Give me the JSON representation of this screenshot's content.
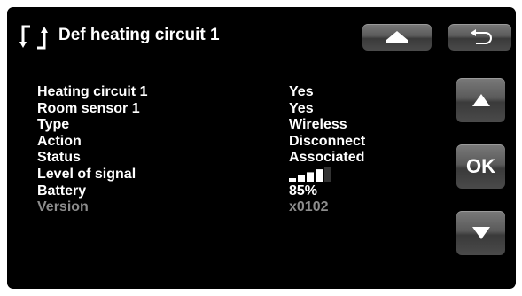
{
  "header": {
    "title": "Def heating circuit 1",
    "icon": "refresh-bracket-icon"
  },
  "nav": {
    "home": "home-icon",
    "back": "back-arrow-icon",
    "up": "up-arrow-icon",
    "ok": "OK",
    "down": "down-arrow-icon"
  },
  "rows": [
    {
      "label": "Heating circuit 1",
      "value": "Yes"
    },
    {
      "label": "Room sensor 1",
      "value": "Yes"
    },
    {
      "label": "Type",
      "value": "Wireless"
    },
    {
      "label": "Action",
      "value": "Disconnect"
    },
    {
      "label": "Status",
      "value": "Associated"
    },
    {
      "label": "Level of signal",
      "signal_bars": 4,
      "signal_max": 5
    },
    {
      "label": "Battery",
      "value": "85%"
    },
    {
      "label": "Version",
      "value": "x0102"
    }
  ],
  "colors": {
    "background": "#000000",
    "text": "#ffffff",
    "text_disabled": "#8c8c8c",
    "button": "#5a5a5a"
  }
}
